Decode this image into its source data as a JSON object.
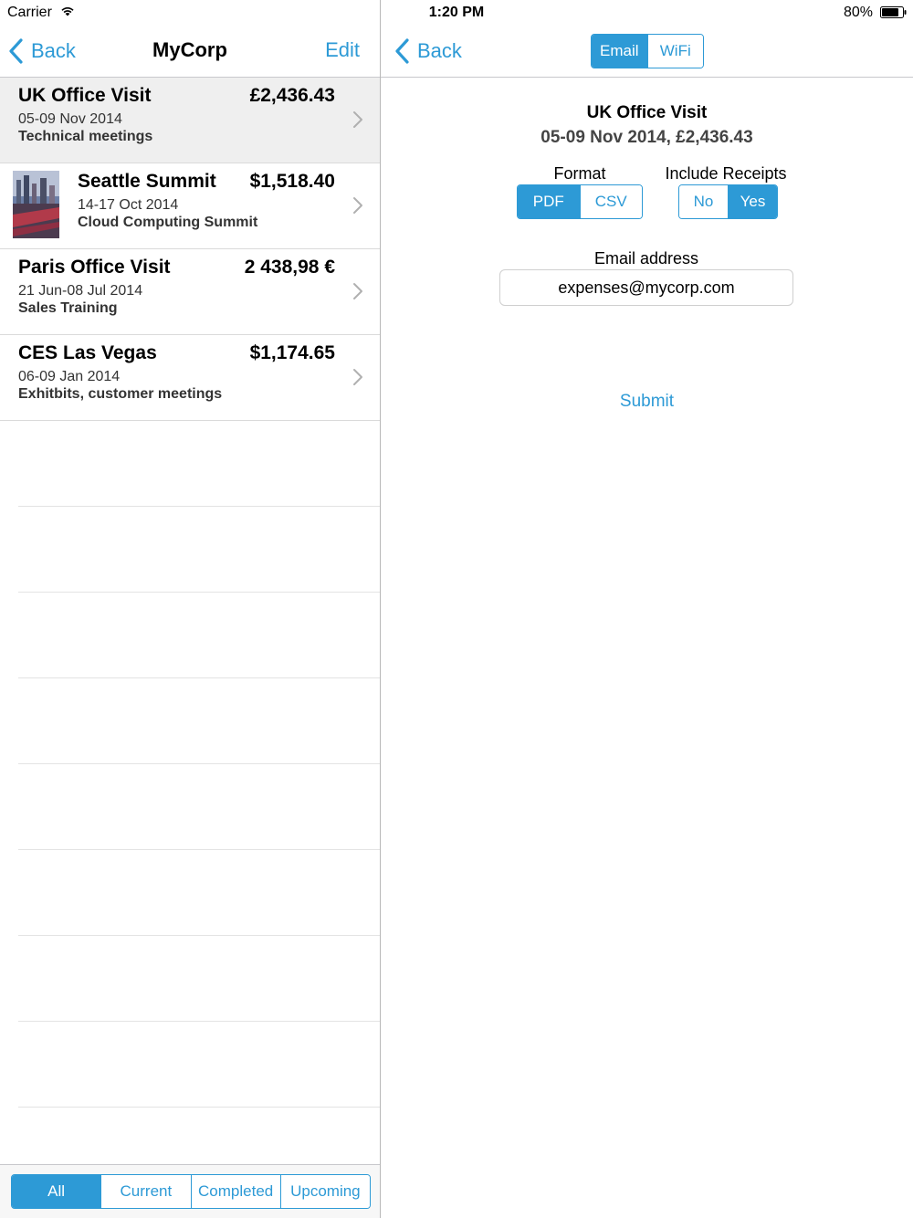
{
  "status": {
    "carrier": "Carrier",
    "time": "1:20 PM",
    "battery_pct": "80%"
  },
  "colors": {
    "accent": "#2d9ad6",
    "selected_row": "#efefef",
    "separator": "#dadada"
  },
  "master": {
    "back_label": "Back",
    "title": "MyCorp",
    "edit_label": "Edit",
    "trips": [
      {
        "name": "UK Office Visit",
        "amount": "£2,436.43",
        "dates": "05-09 Nov 2014",
        "desc": "Technical meetings",
        "selected": true,
        "thumbnail": false
      },
      {
        "name": "Seattle Summit",
        "amount": "$1,518.40",
        "dates": "14-17 Oct 2014",
        "desc": "Cloud Computing Summit",
        "selected": false,
        "thumbnail": true
      },
      {
        "name": "Paris Office Visit",
        "amount": "2 438,98 €",
        "dates": "21 Jun-08 Jul 2014",
        "desc": "Sales Training",
        "selected": false,
        "thumbnail": false
      },
      {
        "name": "CES Las Vegas",
        "amount": "$1,174.65",
        "dates": "06-09 Jan 2014",
        "desc": "Exhitbits, customer meetings",
        "selected": false,
        "thumbnail": false
      }
    ],
    "filters": [
      "All",
      "Current",
      "Completed",
      "Upcoming"
    ],
    "active_filter": "All"
  },
  "detail": {
    "back_label": "Back",
    "modes": [
      "Email",
      "WiFi"
    ],
    "active_mode": "Email",
    "title": "UK Office Visit",
    "subtitle": "05-09 Nov 2014, £2,436.43",
    "format_label": "Format",
    "formats": [
      "PDF",
      "CSV"
    ],
    "active_format": "PDF",
    "receipts_label": "Include Receipts",
    "receipt_options": [
      "No",
      "Yes"
    ],
    "active_receipt": "Yes",
    "email_label": "Email address",
    "email_value": "expenses@mycorp.com",
    "submit_label": "Submit"
  }
}
